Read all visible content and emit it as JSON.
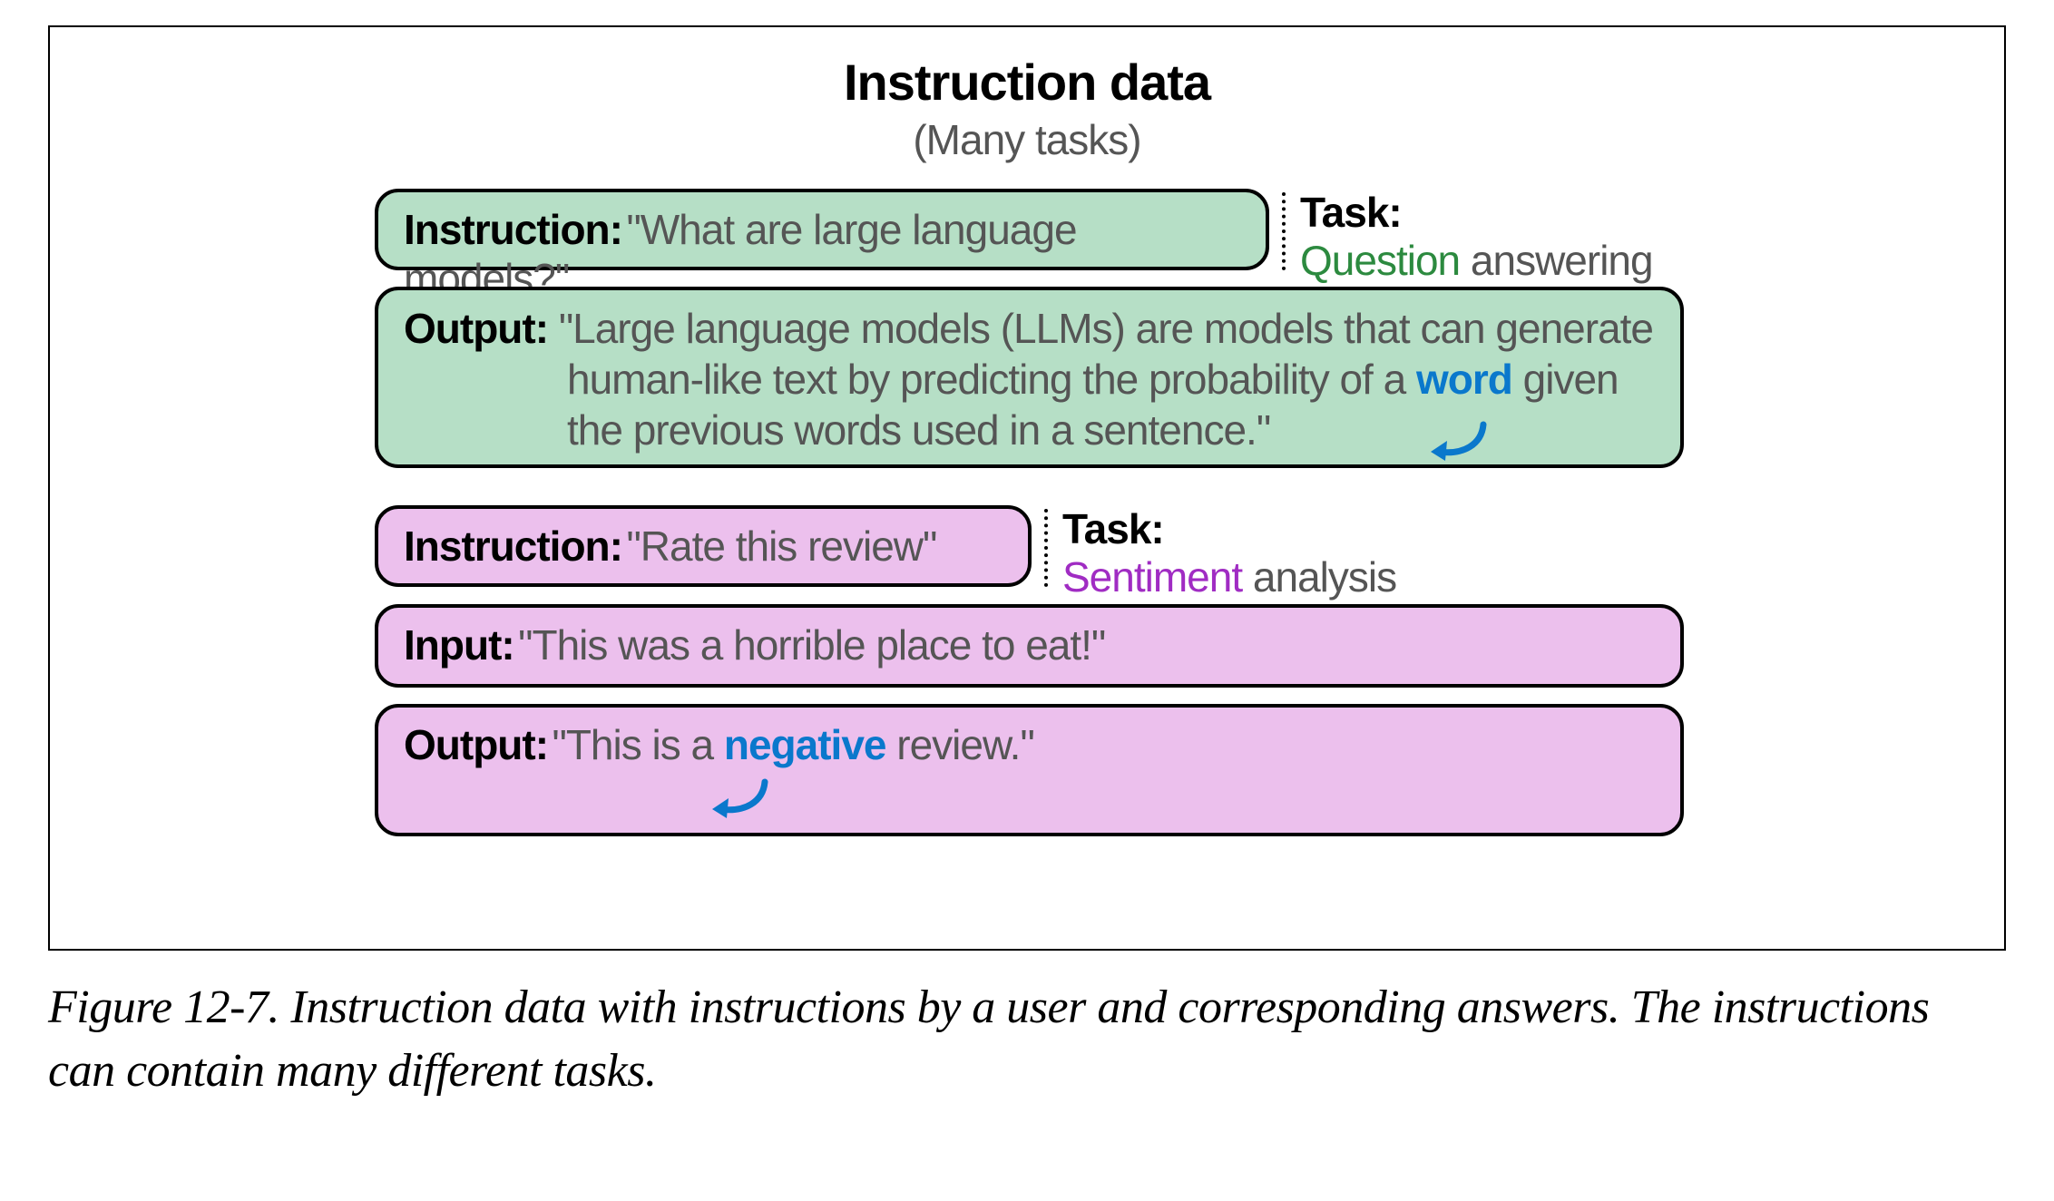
{
  "header": {
    "title": "Instruction data",
    "subtitle": "(Many tasks)"
  },
  "ex1": {
    "instr_label": "Instruction:",
    "instr_text": "\"What are large language models?\"",
    "task_head": "Task:",
    "task_hl": "Question",
    "task_rest": " answering",
    "out_label": "Output:",
    "out_pre": "\"Large language models (LLMs) are models that can generate human-like text by predicting the probability of a ",
    "out_hl": "word",
    "out_post": " given the previous words used in a sentence.\""
  },
  "ex2": {
    "instr_label": "Instruction:",
    "instr_text": "\"Rate this review\"",
    "task_head": "Task:",
    "task_hl": "Sentiment",
    "task_rest": " analysis",
    "in_label": "Input:",
    "in_text": "\"This was a horrible place to eat!\"",
    "out_label": "Output:",
    "out_pre": "\"This is a ",
    "out_hl": "negative",
    "out_post": " review.\""
  },
  "caption": "Figure 12-7. Instruction data with instructions by a user and corresponding answers. The instructions can contain many different tasks."
}
